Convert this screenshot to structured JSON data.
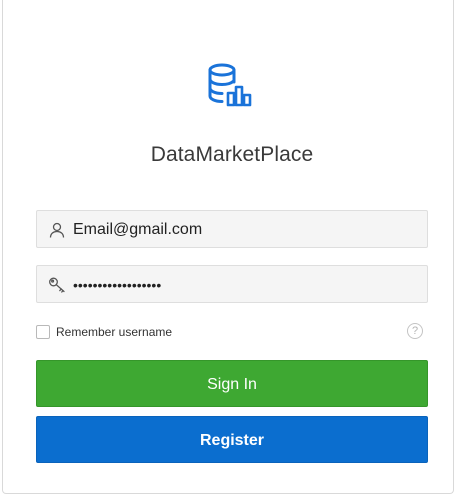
{
  "app": {
    "title": "DataMarketPlace",
    "accent_color": "#1a73d9"
  },
  "logo": {
    "icon": "database-chart-icon"
  },
  "form": {
    "username": {
      "icon": "user-icon",
      "value": "Email@gmail.com"
    },
    "password": {
      "icon": "key-icon",
      "value": "••••••••••••••••••"
    },
    "remember": {
      "label": "Remember username",
      "checked": false
    },
    "help_icon": "help-icon",
    "help_glyph": "?"
  },
  "buttons": {
    "signin_label": "Sign In",
    "signin_color": "#3ea832",
    "register_label": "Register",
    "register_color": "#0b6ecf"
  }
}
